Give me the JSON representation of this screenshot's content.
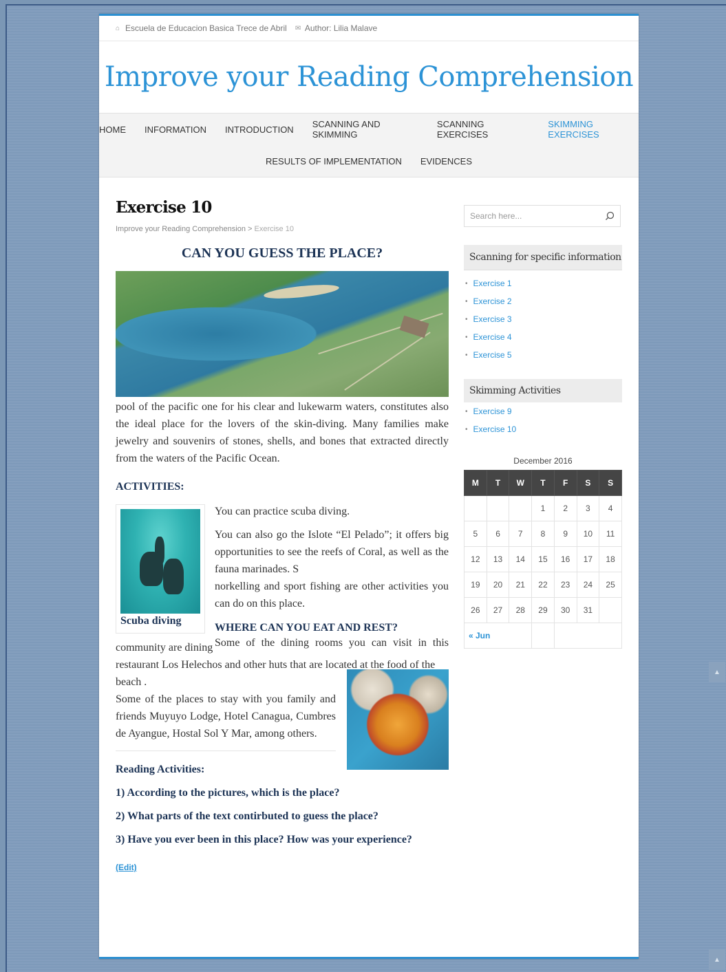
{
  "topbar": {
    "school": "Escuela de Educacion Basica Trece de Abril",
    "author": "Author: Lilia Malave"
  },
  "site": {
    "title": "Improve your Reading Comprehension"
  },
  "nav": {
    "row1": [
      "HOME",
      "INFORMATION",
      "INTRODUCTION",
      "SCANNING AND SKIMMING",
      "SCANNING EXERCISES",
      "SKIMMING EXERCISES"
    ],
    "row2": [
      "RESULTS OF IMPLEMENTATION",
      "EVIDENCES"
    ],
    "active": "SKIMMING EXERCISES"
  },
  "post": {
    "title": "Exercise 10",
    "breadcrumb_home": "Improve your Reading Comprehension",
    "breadcrumb_sep": ">",
    "breadcrumb_current": "Exercise 10",
    "headline": "CAN YOU GUESS THE PLACE?",
    "intro_para": "pool of the pacific one for his clear and lukewarm waters, constitutes also the ideal place for the lovers of the skin-diving. Many families make jewelry and souvenirs of stones, shells, and bones that extracted directly from the waters of the Pacific Ocean.",
    "activities_heading": "ACTIVITIES:",
    "scuba_caption": "Scuba diving",
    "act_p1": "You can practice scuba diving.",
    "act_p2": "You can also go the Islote “El Pelado”; it offers big opportunities to see the reefs of Coral, as well as the fauna marinades. S",
    "act_p3": "norkelling and sport  fishing are other activities you can do on this place.",
    "eat_heading": "WHERE CAN YOU EAT AND REST?",
    "eat_p1": "Some of the dining rooms you can visit in this",
    "eat_p2": "community are dining",
    "eat_p3": "restaurant Los Helechos and other huts that are located at the food of the",
    "eat_p4": "beach .",
    "stay_p": "Some of the places to stay with you family and friends Muyuyo Lodge, Hotel Canagua, Cumbres de Ayangue, Hostal Sol  Y Mar, among others.",
    "reading_heading": "Reading Activities:",
    "questions": [
      "1) According to the pictures, which is the place?",
      "2) What parts of the text contirbuted to guess the place?",
      "3) Have you ever been in this place? How was your experience?"
    ],
    "edit": "(Edit)"
  },
  "sidebar": {
    "search_placeholder": "Search here...",
    "scanning_title": "Scanning for specific information",
    "scanning_items": [
      "Exercise 1",
      "Exercise 2",
      "Exercise 3",
      "Exercise 4",
      "Exercise 5"
    ],
    "skimming_title": "Skimming Activities",
    "skimming_items": [
      "Exercise 9",
      "Exercise 10"
    ],
    "calendar": {
      "caption": "December 2016",
      "days": [
        "M",
        "T",
        "W",
        "T",
        "F",
        "S",
        "S"
      ],
      "weeks": [
        [
          "",
          "",
          "",
          "1",
          "2",
          "3",
          "4"
        ],
        [
          "5",
          "6",
          "7",
          "8",
          "9",
          "10",
          "11"
        ],
        [
          "12",
          "13",
          "14",
          "15",
          "16",
          "17",
          "18"
        ],
        [
          "19",
          "20",
          "21",
          "22",
          "23",
          "24",
          "25"
        ],
        [
          "26",
          "27",
          "28",
          "29",
          "30",
          "31",
          ""
        ]
      ],
      "prev": "« Jun"
    }
  },
  "colors": {
    "accent": "#2c93d6",
    "heading_navy": "#1c3355",
    "page_bg": "#7e9aba"
  }
}
